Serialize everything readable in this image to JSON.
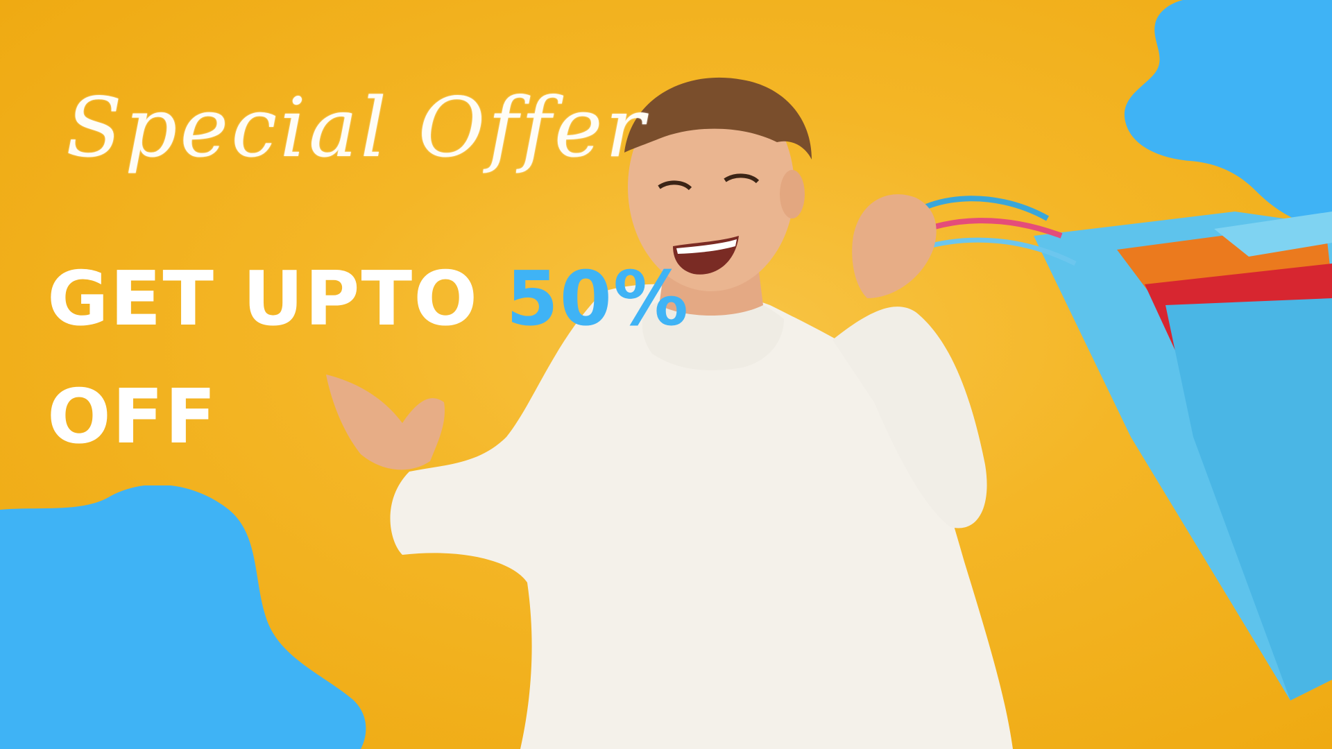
{
  "banner": {
    "script_title": "Special Offer",
    "headline_part1": "GET UPTO",
    "headline_highlight": "50%",
    "headline_part2": "OFF"
  },
  "colors": {
    "background": "#f2b115",
    "accent_blue": "#3fb3f5",
    "text_white": "#ffffff",
    "sweater": "#f4f1ea"
  },
  "icons": [
    "blob-shape",
    "shopping-bags"
  ]
}
